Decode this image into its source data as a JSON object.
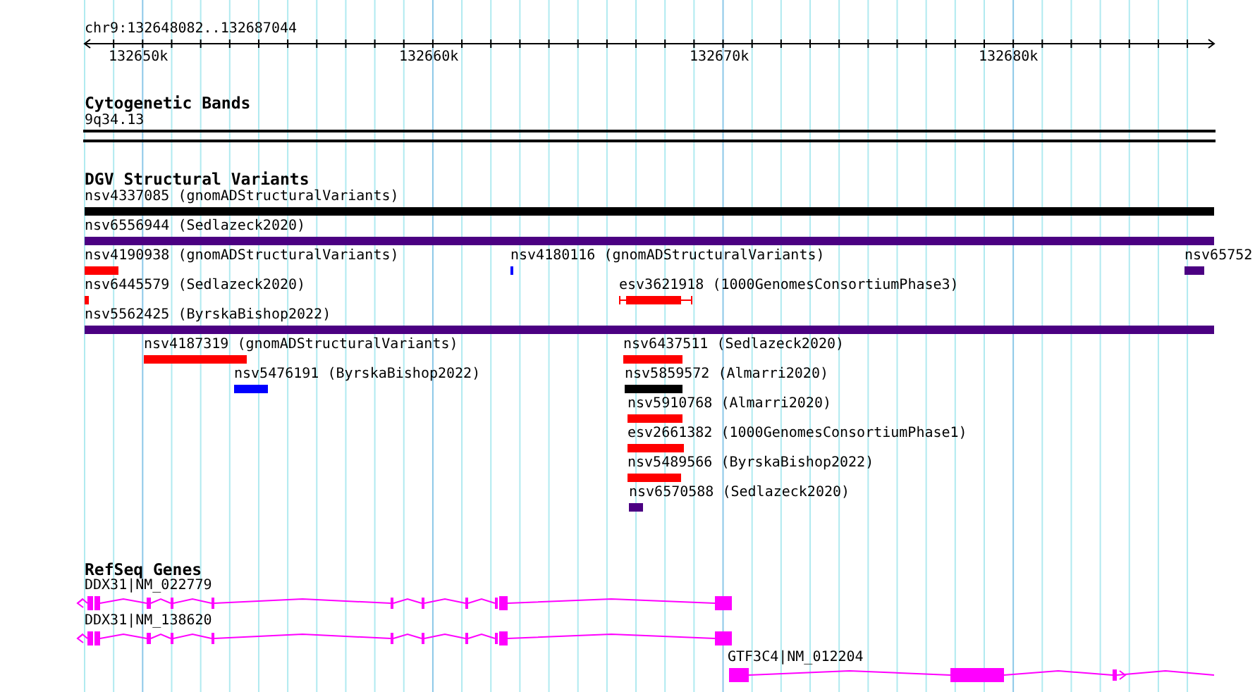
{
  "ruler": {
    "locus": "chr9:132648082..132687044",
    "ticks": [
      "132650k",
      "132660k",
      "132670k",
      "132680k"
    ]
  },
  "tracks": [
    {
      "kind": "bands",
      "title": "Cytogenetic Bands",
      "label": "9q34.13"
    },
    {
      "kind": "variants",
      "title": "DGV Structural Variants",
      "features": [
        {
          "label": "nsv4337085 (gnomADStructuralVariants)",
          "color": "#000000",
          "kind": "bar"
        },
        {
          "label": "nsv6556944 (Sedlazeck2020)",
          "color": "#4b0082",
          "kind": "bar"
        },
        {
          "label": "nsv4190938 (gnomADStructuralVariants)",
          "color": "#ff0000",
          "kind": "bar"
        },
        {
          "label": "nsv4180116 (gnomADStructuralVariants)",
          "color": "#0000ff",
          "kind": "bar"
        },
        {
          "label": "nsv65752",
          "color": "#4b0082",
          "kind": "bar"
        },
        {
          "label": "nsv6445579 (Sedlazeck2020)",
          "color": "#ff0000",
          "kind": "bar"
        },
        {
          "label": "esv3621918 (1000GenomesConsortiumPhase3)",
          "color": "#ff0000",
          "kind": "bracketed"
        },
        {
          "label": "nsv5562425 (ByrskaBishop2022)",
          "color": "#4b0082",
          "kind": "bar"
        },
        {
          "label": "nsv4187319 (gnomADStructuralVariants)",
          "color": "#ff0000",
          "kind": "bar"
        },
        {
          "label": "nsv6437511 (Sedlazeck2020)",
          "color": "#ff0000",
          "kind": "bar"
        },
        {
          "label": "nsv5476191 (ByrskaBishop2022)",
          "color": "#0000ff",
          "kind": "bar"
        },
        {
          "label": "nsv5859572 (Almarri2020)",
          "color": "#000000",
          "kind": "bar"
        },
        {
          "label": "nsv5910768 (Almarri2020)",
          "color": "#ff0000",
          "kind": "bar"
        },
        {
          "label": "esv2661382 (1000GenomesConsortiumPhase1)",
          "color": "#ff0000",
          "kind": "bar"
        },
        {
          "label": "nsv5489566 (ByrskaBishop2022)",
          "color": "#ff0000",
          "kind": "bar"
        },
        {
          "label": "nsv6570588 (Sedlazeck2020)",
          "color": "#4b0082",
          "kind": "bar"
        }
      ]
    },
    {
      "kind": "genes",
      "title": "RefSeq Genes",
      "features": [
        {
          "label": "DDX31|NM_022779",
          "reverse": true
        },
        {
          "label": "DDX31|NM_138620",
          "reverse": true
        },
        {
          "label": "GTF3C4|NM_012204",
          "reverse": false
        }
      ]
    }
  ]
}
